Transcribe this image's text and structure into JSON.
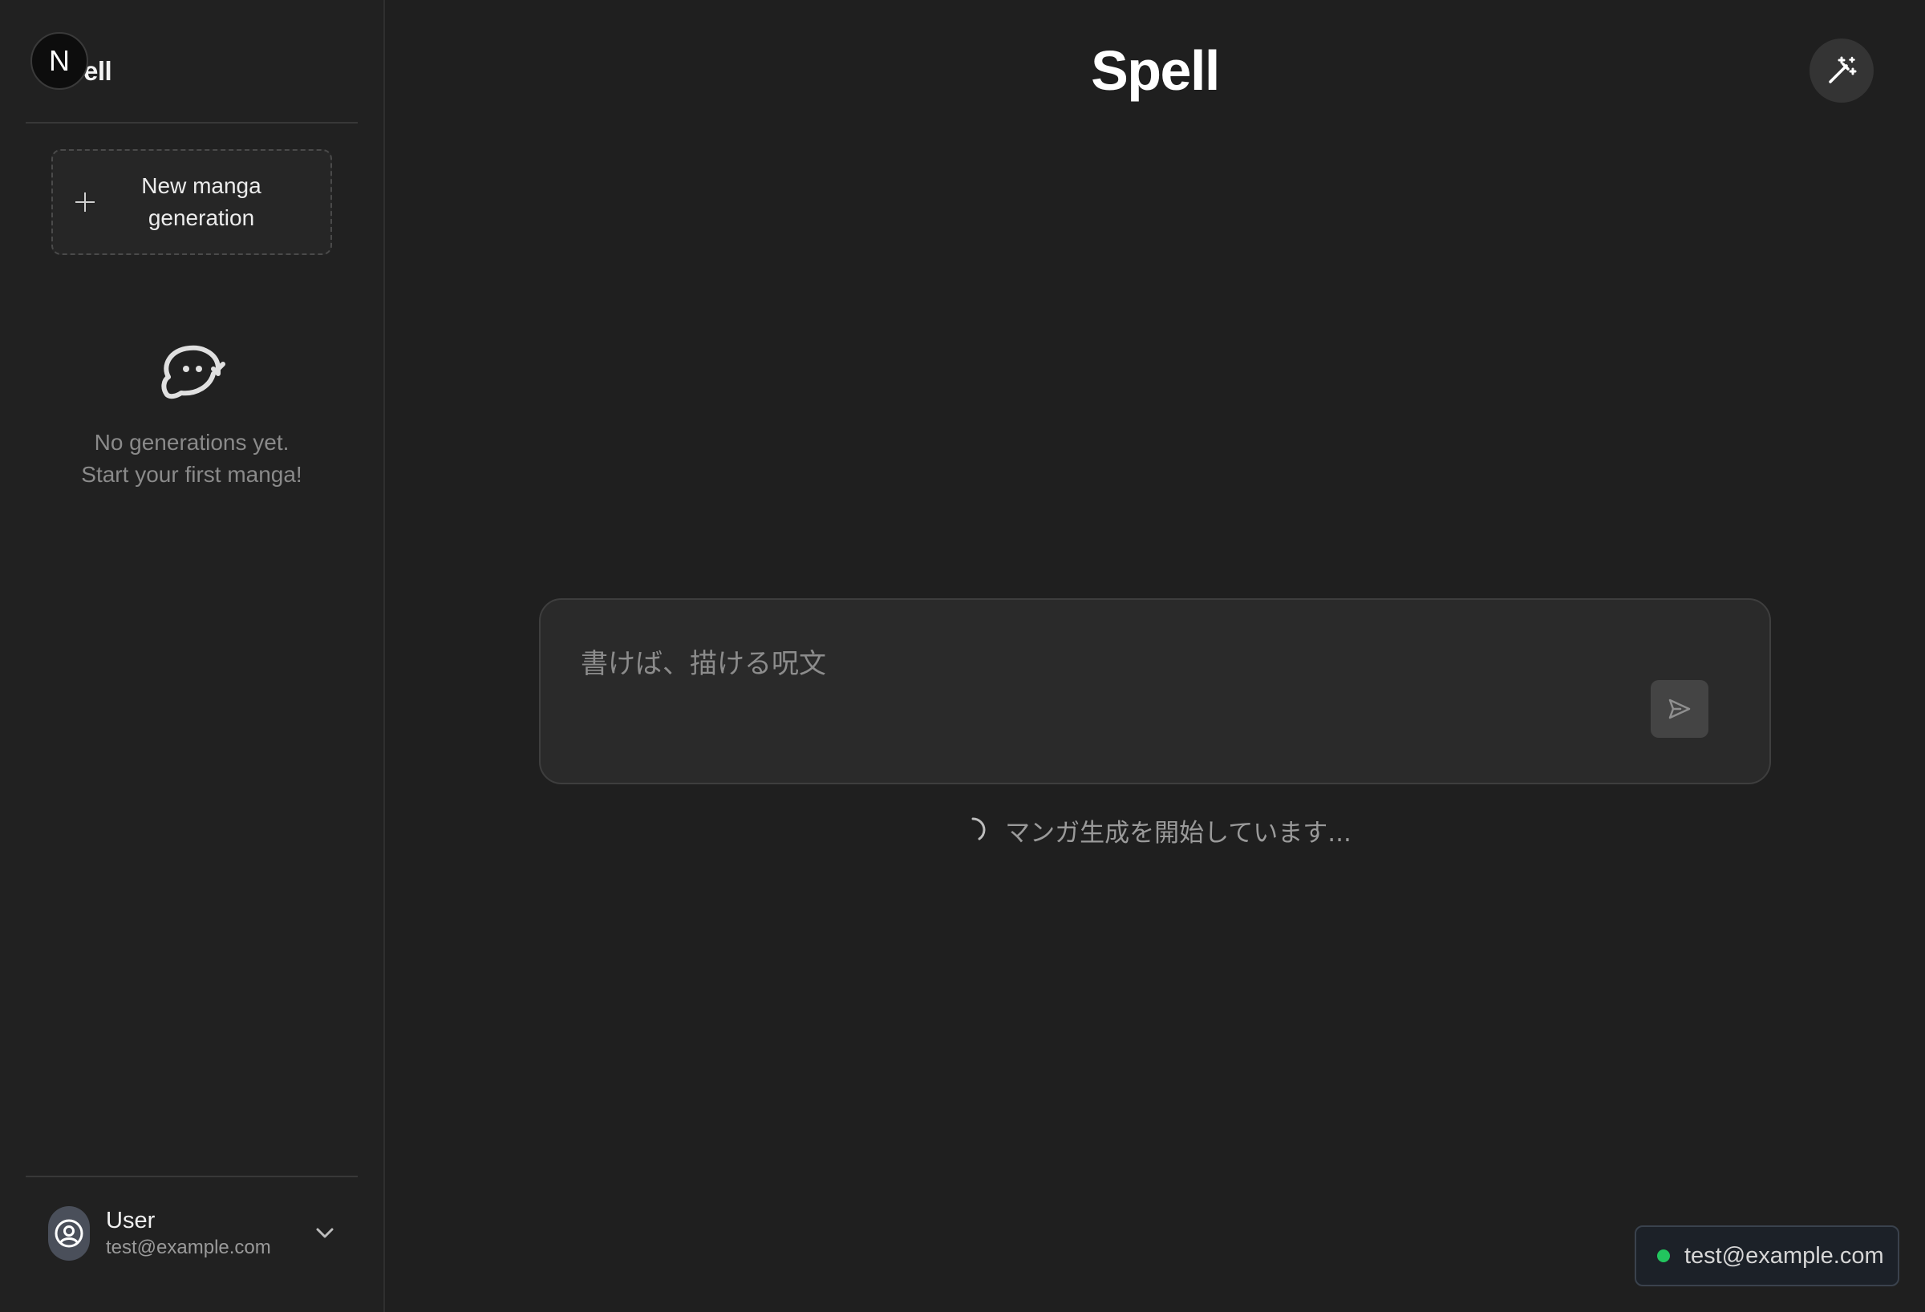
{
  "sidebar": {
    "brand_badge": "N",
    "brand_text": "ell",
    "new_button_label": "New manga\ngeneration",
    "empty_state": {
      "line1": "No generations yet.",
      "line2": "Start your first manga!"
    },
    "user": {
      "name": "User",
      "email": "test@example.com"
    }
  },
  "main": {
    "title": "Spell",
    "prompt": {
      "placeholder": "書けば、描ける呪文",
      "value": ""
    },
    "status_text": "マンガ生成を開始しています..."
  },
  "session_badge": {
    "email": "test@example.com",
    "status_color": "#22c55e"
  },
  "icons": {
    "new_button": "plus-icon",
    "empty_state": "chat-bubble-icon",
    "avatar": "user-circle-icon",
    "user_menu": "chevron-down-icon",
    "magic": "magic-wand-icon",
    "send": "send-icon",
    "loading": "spinner-icon"
  }
}
